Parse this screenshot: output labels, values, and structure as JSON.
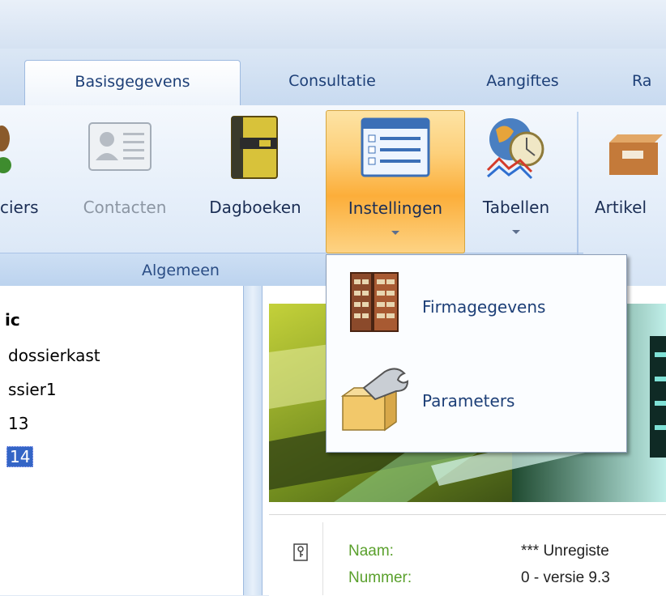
{
  "tabs": [
    {
      "label": "Basisgegevens",
      "active": true
    },
    {
      "label": "Consultatie",
      "active": false
    },
    {
      "label": "Aangiftes",
      "active": false
    },
    {
      "label": "Ra",
      "active": false
    }
  ],
  "ribbon": {
    "buttons": {
      "dossiers": "ciers",
      "contacten": "Contacten",
      "dagboeken": "Dagboeken",
      "instellingen": "Instellingen",
      "tabellen": "Tabellen",
      "artikel": "Artikel"
    },
    "group_label": "Algemeen"
  },
  "dropdown": {
    "items": [
      "Firmagegevens",
      "Parameters"
    ]
  },
  "tree": {
    "items": [
      "ic",
      "dossierkast",
      "ssier1",
      "13",
      "14"
    ]
  },
  "info": {
    "rows": [
      {
        "label": "Naam:",
        "value": "*** Unregiste"
      },
      {
        "label": "Nummer:",
        "value": "0 - versie 9.3"
      }
    ]
  },
  "colors": {
    "accent": "#fcae3a",
    "tab_text": "#1d3f77",
    "info_label": "#5aa02c",
    "selection": "#3465c6"
  }
}
